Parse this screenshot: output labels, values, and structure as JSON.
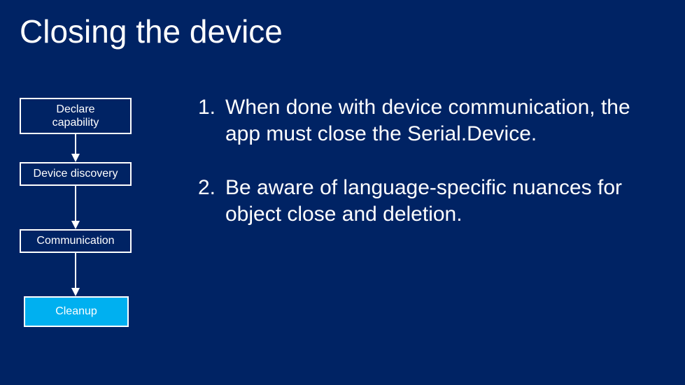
{
  "title": "Closing the device",
  "diagram": {
    "steps": [
      {
        "label": "Declare\ncapability"
      },
      {
        "label": "Device discovery"
      },
      {
        "label": "Communication"
      },
      {
        "label": "Cleanup"
      }
    ]
  },
  "list": {
    "items": [
      {
        "num": "1.",
        "text": "When done with device communication, the app must close the Serial.Device."
      },
      {
        "num": "2.",
        "text": "Be aware of language-specific nuances for object close and deletion."
      }
    ]
  }
}
